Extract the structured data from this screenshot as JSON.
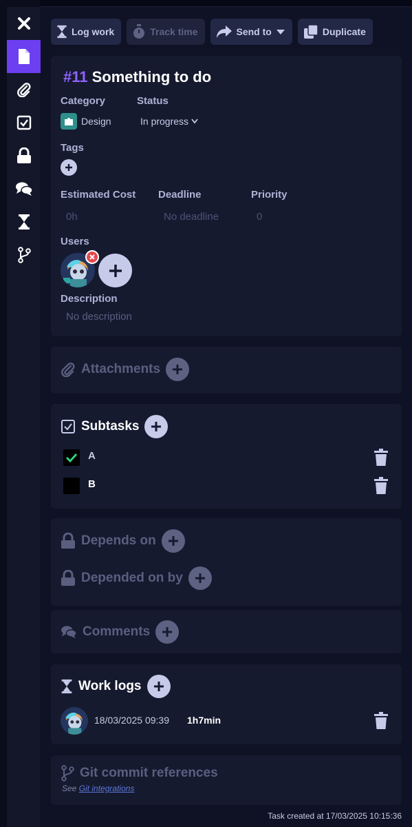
{
  "toolbar": {
    "log_work": "Log work",
    "track_time": "Track time",
    "send_to": "Send to",
    "duplicate": "Duplicate"
  },
  "sidebar": {
    "items": [
      "close-icon",
      "file-icon",
      "paperclip-icon",
      "checkbox-icon",
      "lock-icon",
      "comments-icon",
      "hourglass-icon",
      "git-branch-icon"
    ]
  },
  "task": {
    "number": "#11",
    "title": "Something to do",
    "category_label": "Category",
    "category_value": "Design",
    "status_label": "Status",
    "status_value": "In progress",
    "tags_label": "Tags",
    "estimated_cost_label": "Estimated Cost",
    "estimated_cost_value": "0h",
    "deadline_label": "Deadline",
    "deadline_value": "No deadline",
    "priority_label": "Priority",
    "priority_value": "0",
    "users_label": "Users",
    "description_label": "Description",
    "description_value": "No description"
  },
  "attachments": {
    "title": "Attachments"
  },
  "subtasks": {
    "title": "Subtasks",
    "items": [
      {
        "label": "A",
        "checked": true
      },
      {
        "label": "B",
        "checked": false
      }
    ]
  },
  "dependencies": {
    "depends_on": "Depends on",
    "depended_on_by": "Depended on by"
  },
  "comments": {
    "title": "Comments"
  },
  "work_logs": {
    "title": "Work logs",
    "entries": [
      {
        "date": "18/03/2025 09:39",
        "duration": "1h7min"
      }
    ]
  },
  "git": {
    "title": "Git commit references",
    "see": "See",
    "link": "Git integrations"
  },
  "footer": {
    "created": "Task created at 17/03/2025 10:15:36"
  },
  "colors": {
    "accent": "#6c3ff0",
    "number": "#8f63ff",
    "check": "#2fd27c",
    "remove": "#e5484d"
  }
}
